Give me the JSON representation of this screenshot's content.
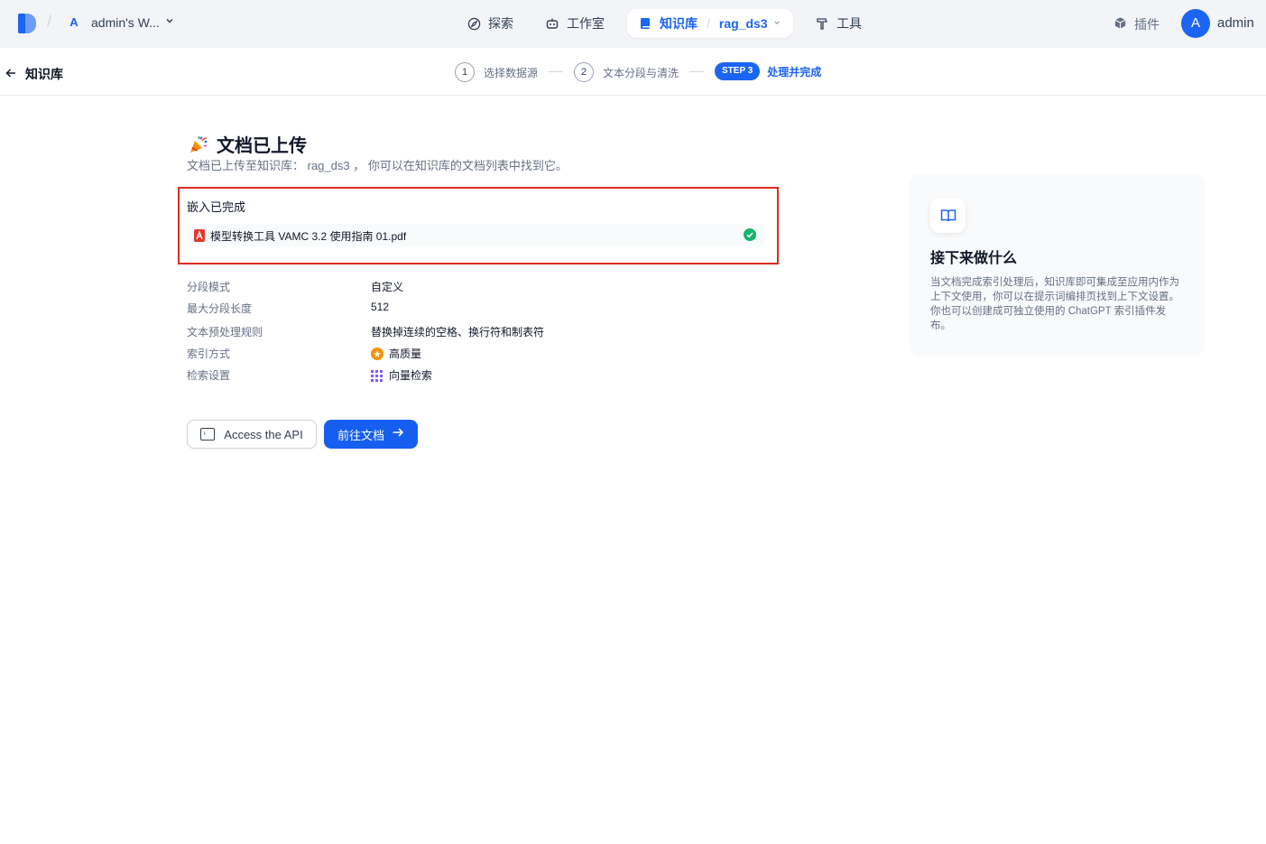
{
  "header": {
    "workspace_avatar": "A",
    "workspace_name": "admin's W...",
    "nav": {
      "explore": "探索",
      "studio": "工作室",
      "knowledge": "知识库",
      "dataset": "rag_ds3",
      "tools": "工具"
    },
    "plugins": "插件",
    "user_avatar": "A",
    "user_name": "admin"
  },
  "stepbar": {
    "back_label": "知识库",
    "step1_num": "1",
    "step1_label": "选择数据源",
    "step2_num": "2",
    "step2_label": "文本分段与清洗",
    "step3_pill": "STEP 3",
    "step3_label": "处理并完成"
  },
  "main": {
    "title": "文档已上传",
    "subtitle": "文档已上传至知识库： rag_ds3 ， 你可以在知识库的文档列表中找到它。",
    "embed_label": "嵌入已完成",
    "file_name": "模型转换工具 VAMC 3.2 使用指南 01.pdf",
    "info": {
      "segment_mode_label": "分段模式",
      "segment_mode_value": "自定义",
      "max_length_label": "最大分段长度",
      "max_length_value": "512",
      "preprocess_label": "文本预处理规则",
      "preprocess_value": "替换掉连续的空格、换行符和制表符",
      "index_label": "索引方式",
      "index_value": "高质量",
      "retrieval_label": "检索设置",
      "retrieval_value": "向量检索"
    },
    "btn_api": "Access the API",
    "btn_doc": "前往文档"
  },
  "next": {
    "title": "接下来做什么",
    "desc": "当文档完成索引处理后，知识库即可集成至应用内作为上下文使用，你可以在提示词编排页找到上下文设置。你也可以创建成可独立使用的 ChatGPT 索引插件发布。"
  },
  "colors": {
    "accent": "#1c64f2",
    "highlight_border": "#d92d20",
    "success": "#12b76a",
    "high_quality": "#f79009"
  }
}
